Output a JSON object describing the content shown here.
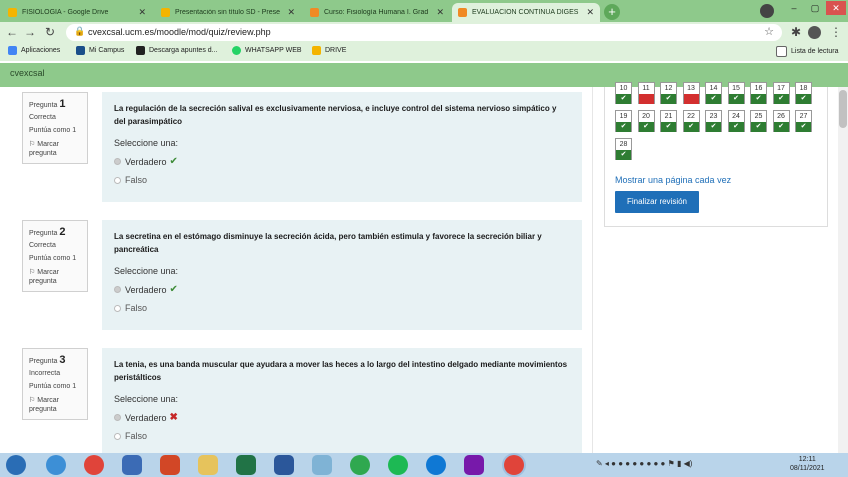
{
  "browser": {
    "tabs": [
      {
        "title": "FISIOLOGÍA - Google Drive",
        "active": false
      },
      {
        "title": "Presentación sin título SD - Prese",
        "active": false
      },
      {
        "title": "Curso: Fisiología Humana I. Grad",
        "active": false
      },
      {
        "title": "EVALUACIÓN CONTINUA DIGES",
        "active": true
      }
    ],
    "url": "cvexcsal.ucm.es/moodle/mod/quiz/review.php",
    "bookmarks": [
      "Aplicaciones",
      "Mi Campus",
      "Descarga apuntes d...",
      "WHATSAPP WEB",
      "DRIVE"
    ],
    "reading_list": "Lista de lectura"
  },
  "site": {
    "name": "cvexcsal"
  },
  "questions": [
    {
      "label": "Pregunta",
      "number": "1",
      "status": "Correcta",
      "points": "Puntúa como 1",
      "flag": "Marcar pregunta",
      "text": "La regulación de la secreción salival es exclusivamente nerviosa, e incluye control del sistema nervioso simpático y del parasimpático",
      "prompt": "Seleccione una:",
      "options": [
        "Verdadero",
        "Falso"
      ],
      "mark": "✔"
    },
    {
      "label": "Pregunta",
      "number": "2",
      "status": "Correcta",
      "points": "Puntúa como 1",
      "flag": "Marcar pregunta",
      "text": "La secretina en el estómago disminuye la secreción ácida, pero también estimula y favorece la secreción biliar y pancreática",
      "prompt": "Seleccione una:",
      "options": [
        "Verdadero",
        "Falso"
      ],
      "mark": "✔"
    },
    {
      "label": "Pregunta",
      "number": "3",
      "status": "Incorrecta",
      "points": "Puntúa como 1",
      "flag": "Marcar pregunta",
      "text": "La tenia, es una banda muscular que ayudara a mover las heces a lo largo del intestino delgado mediante movimientos peristálticos",
      "prompt": "Seleccione una:",
      "options": [
        "Verdadero",
        "Falso"
      ],
      "mark": "✖"
    }
  ],
  "quiz_nav": {
    "buttons": [
      {
        "n": "10",
        "state": "correct"
      },
      {
        "n": "11",
        "state": "incorrect"
      },
      {
        "n": "12",
        "state": "correct"
      },
      {
        "n": "13",
        "state": "incorrect"
      },
      {
        "n": "14",
        "state": "correct"
      },
      {
        "n": "15",
        "state": "correct"
      },
      {
        "n": "16",
        "state": "correct"
      },
      {
        "n": "17",
        "state": "correct"
      },
      {
        "n": "18",
        "state": "correct"
      },
      {
        "n": "19",
        "state": "correct"
      },
      {
        "n": "20",
        "state": "correct"
      },
      {
        "n": "21",
        "state": "correct"
      },
      {
        "n": "22",
        "state": "correct"
      },
      {
        "n": "23",
        "state": "correct"
      },
      {
        "n": "24",
        "state": "correct"
      },
      {
        "n": "25",
        "state": "correct"
      },
      {
        "n": "26",
        "state": "correct"
      },
      {
        "n": "27",
        "state": "correct"
      },
      {
        "n": "28",
        "state": "correct"
      }
    ],
    "show_one_page": "Mostrar una página cada vez",
    "finish": "Finalizar revisión"
  },
  "taskbar": {
    "clock_time": "12:11",
    "clock_date": "08/11/2021"
  },
  "colors": {
    "header_green": "#8ec98b",
    "correct": "#2e7d32",
    "incorrect": "#d32f2f",
    "link": "#1f6fb8",
    "question_bg": "#e8f2f4"
  }
}
